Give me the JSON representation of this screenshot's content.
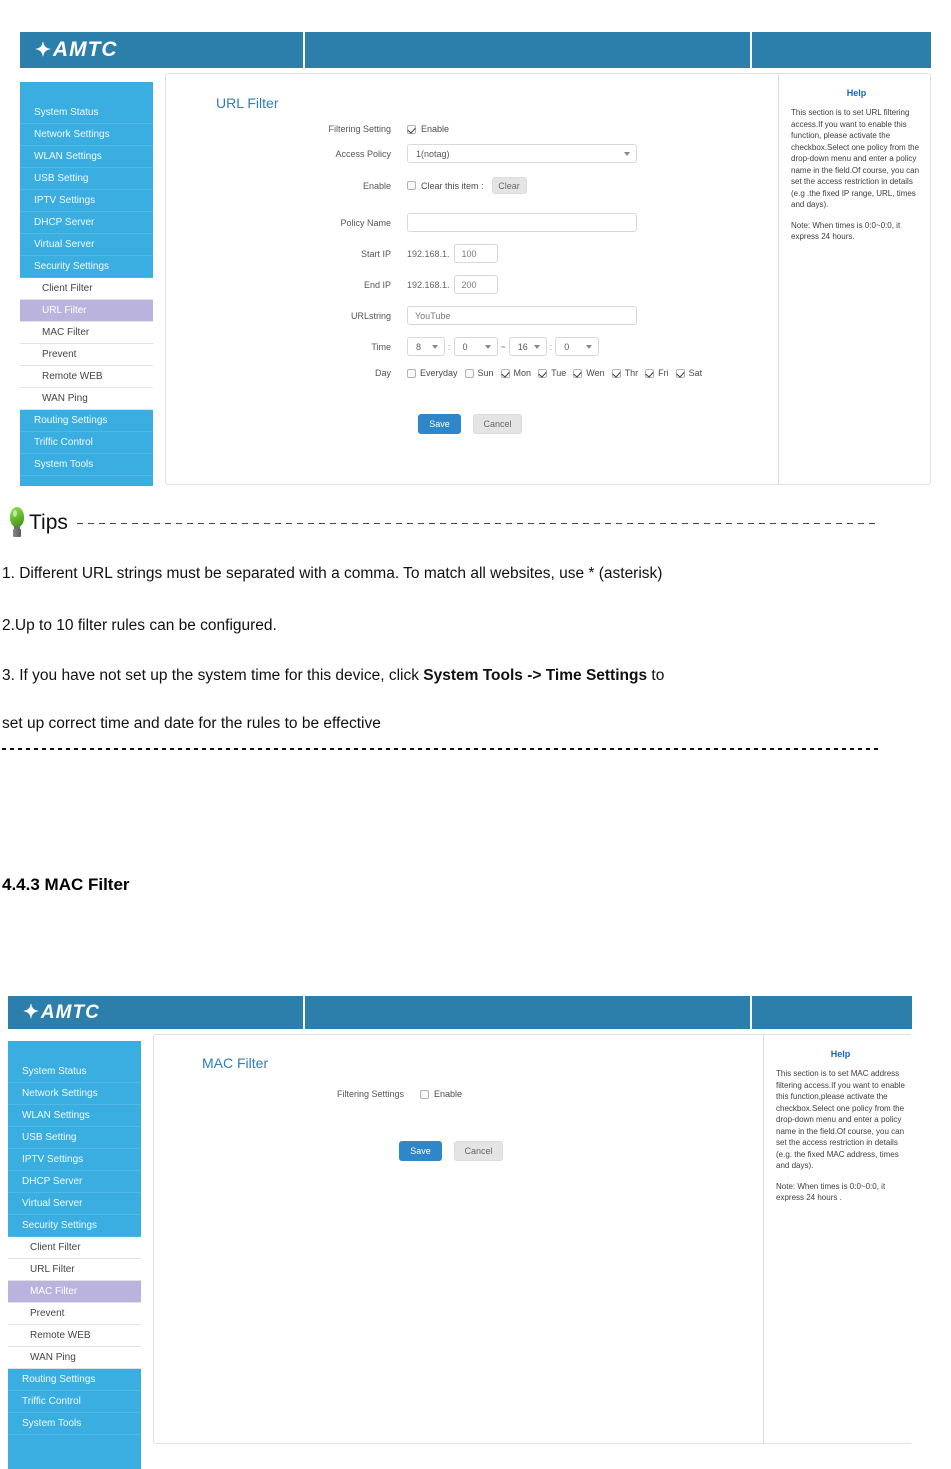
{
  "brand": {
    "logo_text": "AMTC",
    "header_color": "#2c7fab"
  },
  "sidebar": {
    "main_items": [
      {
        "label": "System Status"
      },
      {
        "label": "Network Settings"
      },
      {
        "label": "WLAN Settings"
      },
      {
        "label": "USB Setting"
      },
      {
        "label": "IPTV Settings"
      },
      {
        "label": "DHCP Server"
      },
      {
        "label": "Virtual Server"
      },
      {
        "label": "Security Settings"
      }
    ],
    "sub_items": [
      {
        "label": "Client Filter"
      },
      {
        "label": "URL Filter"
      },
      {
        "label": "MAC Filter"
      },
      {
        "label": "Prevent"
      },
      {
        "label": "Remote WEB"
      },
      {
        "label": "WAN Ping"
      }
    ],
    "tail_items": [
      {
        "label": "Routing Settings"
      },
      {
        "label": "Triffic Control"
      },
      {
        "label": "System Tools"
      }
    ],
    "active_color": "#b9b3de"
  },
  "url_filter": {
    "panel_title": "URL Filter",
    "labels": {
      "filtering_setting": "Filtering Setting",
      "access_policy": "Access Policy",
      "enable": "Enable",
      "policy_name": "Policy Name",
      "start_ip": "Start IP",
      "end_ip": "End IP",
      "urlstring": "URLstring",
      "time": "Time",
      "day": "Day"
    },
    "enable_checkbox_label": "Enable",
    "enable_checked": true,
    "access_policy_value": "1(notag)",
    "clear_item_label": "Clear this item :",
    "clear_item_checked": false,
    "clear_button": "Clear",
    "policy_name_value": "",
    "ip_prefix": "192.168.1.",
    "start_ip_value": "100",
    "end_ip_value": "200",
    "urlstring_value": "YouTube",
    "time_start_hour": "8",
    "time_start_min": "0",
    "time_end_hour": "16",
    "time_end_min": "0",
    "time_separator": "~",
    "days": [
      {
        "label": "Everyday",
        "checked": false
      },
      {
        "label": "Sun",
        "checked": false
      },
      {
        "label": "Mon",
        "checked": true
      },
      {
        "label": "Tue",
        "checked": true
      },
      {
        "label": "Wen",
        "checked": true
      },
      {
        "label": "Thr",
        "checked": true
      },
      {
        "label": "Fri",
        "checked": true
      },
      {
        "label": "Sat",
        "checked": true
      }
    ],
    "save_button": "Save",
    "cancel_button": "Cancel",
    "help_title": "Help",
    "help_body": "This section is to set URL filtering access.If you want to enable this function, please activate the checkbox.Select one policy from the drop-down menu and enter a policy name in the field.Of course, you can set the access restriction in details (e.g .the fixed IP range, URL, times and days).",
    "help_note": "Note: When times is 0:0~0:0, it express 24 hours."
  },
  "tips": {
    "title": "Tips",
    "items": [
      {
        "text": "1. Different URL strings must be separated with a comma. To match all websites, use * (asterisk)"
      },
      {
        "text": "2.Up to 10 filter rules can be configured."
      },
      {
        "pre": "3. If you have not set up the system time for this device, click ",
        "bold": "System Tools -> Time Settings",
        "post": " to"
      },
      {
        "text": "set up correct time and date for the rules to be effective"
      }
    ]
  },
  "section_heading": "4.4.3 MAC Filter",
  "mac_filter": {
    "panel_title": "MAC Filter",
    "labels": {
      "filtering_settings": "Filtering Settings"
    },
    "enable_checkbox_label": "Enable",
    "enable_checked": false,
    "save_button": "Save",
    "cancel_button": "Cancel",
    "help_title": "Help",
    "help_body": "This section is to set MAC address filtering access.If you want to enable this function,please activate the checkbox.Select one policy from the drop-down menu and enter a policy name in the field.Of course, you can set the access restriction in details (e.g. the fixed MAC address, times and days).",
    "help_note": "Note: When times is 0:0~0:0, it express 24 hours ."
  }
}
